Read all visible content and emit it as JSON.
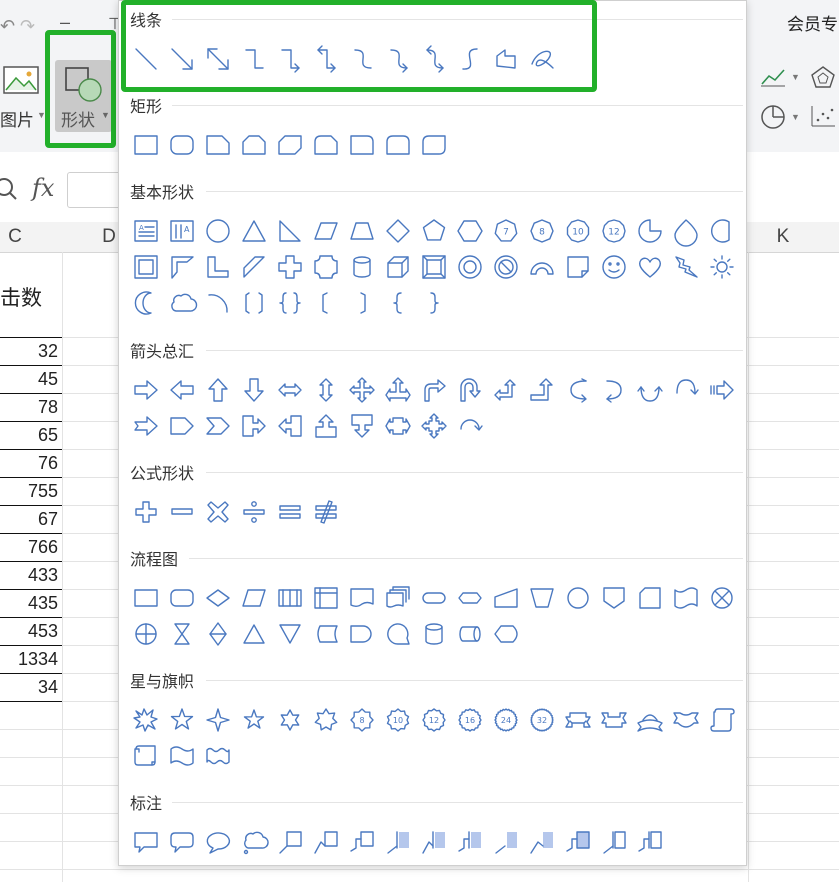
{
  "ribbon": {
    "member_label": "会员专",
    "picture_label": "图片",
    "shape_label": "形状"
  },
  "formula_bar": {
    "fx_label": "fx"
  },
  "columns": [
    "C",
    "D",
    "K"
  ],
  "sheet": {
    "header_cell": "击数",
    "values": [
      "32",
      "45",
      "78",
      "65",
      "76",
      "755",
      "67",
      "766",
      "433",
      "435",
      "453",
      "1334",
      "34"
    ]
  },
  "shape_panel": {
    "sections": [
      {
        "title": "线条",
        "rows": [
          [
            "line",
            "arrow",
            "double-arrow",
            "elbow",
            "elbow-arrow",
            "elbow-double-arrow",
            "curve",
            "curve-arrow",
            "curve-double-arrow",
            "s-curve",
            "freeform",
            "scribble"
          ]
        ]
      },
      {
        "title": "矩形",
        "rows": [
          [
            "rectangle",
            "rounded-rectangle",
            "snip-one-corner",
            "snip-same-side",
            "snip-diagonal",
            "snip-round",
            "round-one-corner",
            "round-same-side",
            "round-diagonal"
          ]
        ]
      },
      {
        "title": "基本形状",
        "rows": [
          [
            "text-box",
            "vertical-text-box",
            "oval",
            "triangle",
            "right-triangle",
            "parallelogram",
            "trapezoid",
            "diamond",
            "pentagon",
            "hexagon",
            "heptagon",
            "octagon",
            "decagon",
            "dodecagon",
            "pie",
            "teardrop",
            "chord"
          ],
          [
            "frame",
            "half-frame",
            "l-shape",
            "diagonal-stripe",
            "cross",
            "plaque",
            "can",
            "cube",
            "bevel",
            "donut",
            "no-symbol",
            "block-arc",
            "folded-corner",
            "smiley-face",
            "heart",
            "lightning-bolt",
            "sun"
          ],
          [
            "moon",
            "cloud",
            "arc",
            "double-bracket",
            "double-brace",
            "left-bracket",
            "right-bracket",
            "left-brace",
            "right-brace"
          ]
        ]
      },
      {
        "title": "箭头总汇",
        "rows": [
          [
            "right-arrow",
            "left-arrow",
            "up-arrow",
            "down-arrow",
            "left-right-arrow",
            "up-down-arrow",
            "quad-arrow",
            "left-right-up-arrow",
            "bent-arrow",
            "u-turn-arrow",
            "left-up-arrow",
            "bent-up-arrow",
            "curved-right-arrow",
            "curved-left-arrow",
            "curved-up-arrow",
            "curved-down-arrow",
            "striped-right-arrow"
          ],
          [
            "notched-right-arrow",
            "pentagon-arrow",
            "chevron",
            "right-arrow-callout",
            "left-arrow-callout",
            "up-arrow-callout",
            "down-arrow-callout",
            "left-right-arrow-callout",
            "quad-arrow-callout",
            "circular-arrow"
          ]
        ]
      },
      {
        "title": "公式形状",
        "rows": [
          [
            "plus",
            "minus",
            "multiply",
            "divide",
            "equal",
            "not-equal"
          ]
        ]
      },
      {
        "title": "流程图",
        "rows": [
          [
            "process",
            "alternate-process",
            "decision",
            "data",
            "predefined-process",
            "internal-storage",
            "document",
            "multidocument",
            "terminator",
            "preparation",
            "manual-input",
            "manual-operation",
            "connector",
            "off-page-connector",
            "card",
            "punched-tape",
            "summing-junction"
          ],
          [
            "or",
            "collate",
            "sort",
            "extract",
            "merge",
            "stored-data",
            "delay",
            "sequential-access-storage",
            "magnetic-disk",
            "direct-access-storage",
            "display"
          ]
        ]
      },
      {
        "title": "星与旗帜",
        "rows": [
          [
            "explosion-1",
            "star-5",
            "star-4",
            "star-5b",
            "star-6",
            "star-7",
            "star-8",
            "star-10",
            "star-12",
            "star-16",
            "star-24",
            "star-32",
            "ribbon-up",
            "ribbon-down",
            "curved-ribbon-up",
            "curved-ribbon-down",
            "vertical-scroll"
          ],
          [
            "horizontal-scroll",
            "wave",
            "double-wave"
          ]
        ]
      },
      {
        "title": "标注",
        "rows": [
          [
            "rect-callout",
            "rounded-rect-callout",
            "oval-callout",
            "cloud-callout",
            "line-callout-1",
            "line-callout-2",
            "line-callout-3",
            "line-callout-4",
            "accent-callout-1",
            "accent-callout-2",
            "accent-callout-3",
            "accent-callout-4",
            "border-callout-1",
            "border-callout-2",
            "border-callout-3"
          ]
        ]
      }
    ]
  },
  "colors": {
    "highlight": "#22b02a",
    "shape_stroke": "#4a78c0",
    "shape_fill_accent": "#b5c7ec"
  }
}
